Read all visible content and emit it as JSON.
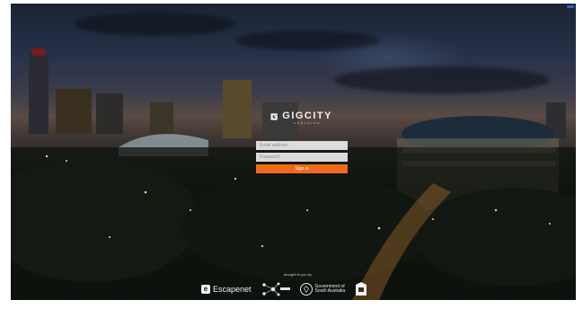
{
  "brand": {
    "name": "GIGCITY",
    "subtitle": "ADELAIDE"
  },
  "form": {
    "email_placeholder": "Email address",
    "password_placeholder": "Password",
    "signin_label": "Sign in"
  },
  "footer": {
    "brought_by": "brought to you by",
    "escapenet_mark": "e",
    "escapenet_label": "Escapenet",
    "govt_line1": "Government of",
    "govt_line2": "South Australia"
  },
  "colors": {
    "accent": "#ef6a1b"
  }
}
